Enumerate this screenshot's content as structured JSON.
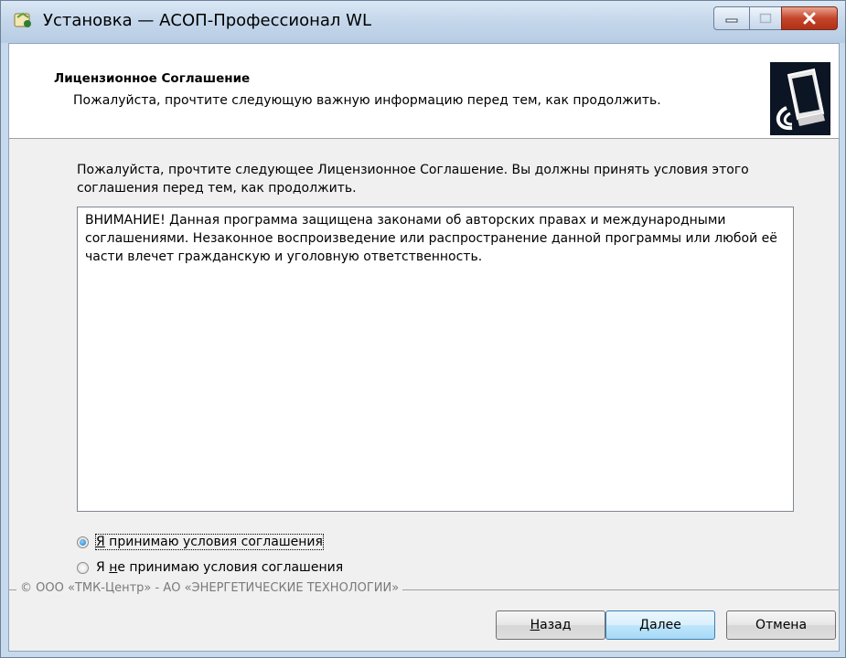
{
  "window": {
    "title": "Установка — АСОП-Профессионал WL"
  },
  "header": {
    "title": "Лицензионное Соглашение",
    "subtitle": "Пожалуйста, прочтите следующую важную информацию перед тем, как продолжить."
  },
  "main": {
    "intro": "Пожалуйста, прочтите следующее Лицензионное Соглашение. Вы должны принять условия этого соглашения перед тем, как продолжить.",
    "license_text": "ВНИМАНИЕ! Данная программа защищена законами об авторских правах и международными соглашениями. Незаконное воспроизведение или распространение данной программы или любой её части влечет гражданскую и уголовную ответственность.",
    "radio_accept": {
      "prefix": "Я",
      "rest": " принимаю условия соглашения",
      "checked": true
    },
    "radio_decline": {
      "prefix": "Я ",
      "mnemonic": "н",
      "rest": "е принимаю условия соглашения",
      "checked": false
    }
  },
  "footer": {
    "copyright": "© ООО «ТМК-Центр» - АО «ЭНЕРГЕТИЧЕСКИЕ ТЕХНОЛОГИИ»",
    "back": {
      "mnemonic": "Н",
      "rest": "азад"
    },
    "next": {
      "mnemonic": "Д",
      "rest": "алее"
    },
    "cancel_label": "Отмена"
  }
}
